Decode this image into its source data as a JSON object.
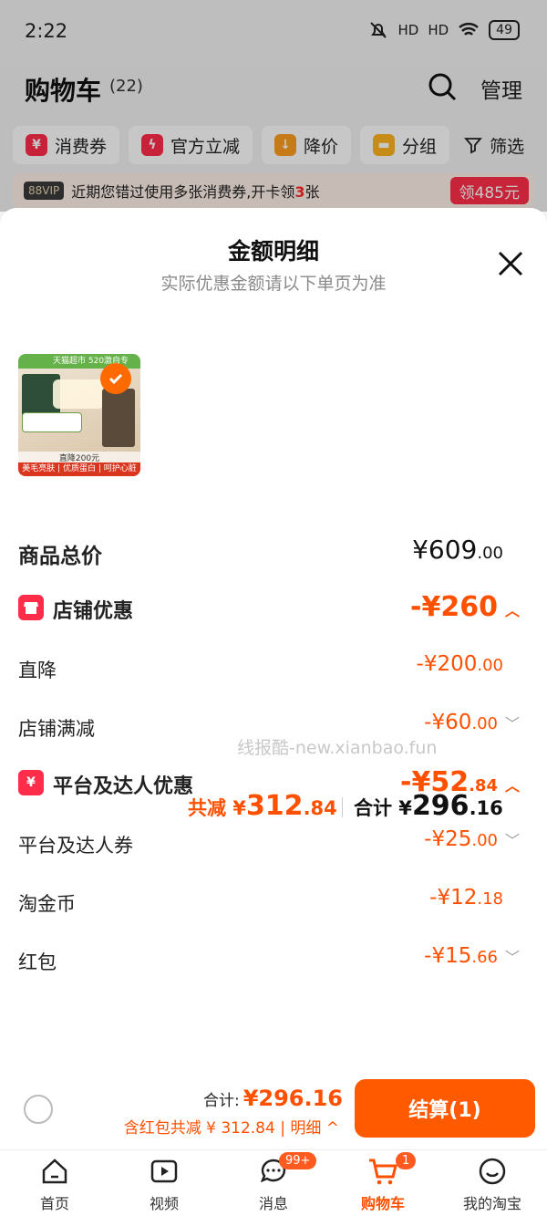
{
  "status_bar": {
    "time": "2:22",
    "signal1": "HD",
    "signal2": "HD",
    "battery": "49"
  },
  "header": {
    "title": "购物车",
    "count": "(22)",
    "manage": "管理"
  },
  "chips": [
    {
      "label": "消费券",
      "icon": "coupon-icon",
      "color": "#ff2c4a"
    },
    {
      "label": "官方立减",
      "icon": "lightning-icon",
      "color": "#ff2c4a"
    },
    {
      "label": "降价",
      "icon": "arrow-down-icon",
      "color": "#ff9d1f"
    },
    {
      "label": "分组",
      "icon": "folder-icon",
      "color": "#ffb21f"
    },
    {
      "label": "筛选",
      "icon": "filter-icon"
    }
  ],
  "vip_banner": {
    "tag": "88VIP",
    "text_prefix": "近期您错过使用多张消费券,开卡领",
    "num": "3",
    "text_suffix": "张",
    "button": "领485元"
  },
  "sheet": {
    "title": "金额明细",
    "subtitle": "实际优惠金额请以下单页为准",
    "product_image": {
      "top_text": "天猫超市 520激自专",
      "price_text": "直降200元",
      "bottom_text": "美毛亮肤 | 优质蛋白 | 呵护心脏  严选"
    },
    "rows": {
      "total": {
        "label": "商品总价",
        "main": "¥609",
        "dec": ".00"
      },
      "store_discount": {
        "label": "店铺优惠",
        "main": "-¥260",
        "dec": ""
      },
      "direct_cut": {
        "label": "直降",
        "main": "-¥200",
        "dec": ".00"
      },
      "store_full_cut": {
        "label": "店铺满减",
        "main": "-¥60",
        "dec": ".00"
      },
      "platform_discount": {
        "label": "平台及达人优惠",
        "main": "-¥52",
        "dec": ".84"
      },
      "platform_coupon": {
        "label": "平台及达人券",
        "main": "-¥25",
        "dec": ".00"
      },
      "gold_coin": {
        "label": "淘金币",
        "main": "-¥12",
        "dec": ".18"
      },
      "red_packet": {
        "label": "红包",
        "main": "-¥15",
        "dec": ".66"
      }
    },
    "watermark": "线报酷-new.xianbao.fun",
    "totals": {
      "saved_label": "共减 ¥",
      "saved_main": "312",
      "saved_dec": ".84",
      "sum_label": "合计 ¥",
      "sum_main": "296",
      "sum_dec": ".16"
    }
  },
  "checkout": {
    "sum_label": "合计:",
    "sum_value": "¥296.16",
    "detail": "含红包共减 ¥ 312.84 | 明细 ^",
    "pay_button": "结算(1)"
  },
  "tabbar": [
    {
      "label": "首页",
      "icon": "home-icon"
    },
    {
      "label": "视频",
      "icon": "video-icon"
    },
    {
      "label": "消息",
      "icon": "message-icon",
      "badge": "99+"
    },
    {
      "label": "购物车",
      "icon": "cart-icon",
      "badge": "1",
      "active": true
    },
    {
      "label": "我的淘宝",
      "icon": "profile-icon"
    }
  ],
  "colors": {
    "accent": "#ff5000",
    "brand_red": "#ff2c4a",
    "pay_button": "#ff5a00"
  }
}
